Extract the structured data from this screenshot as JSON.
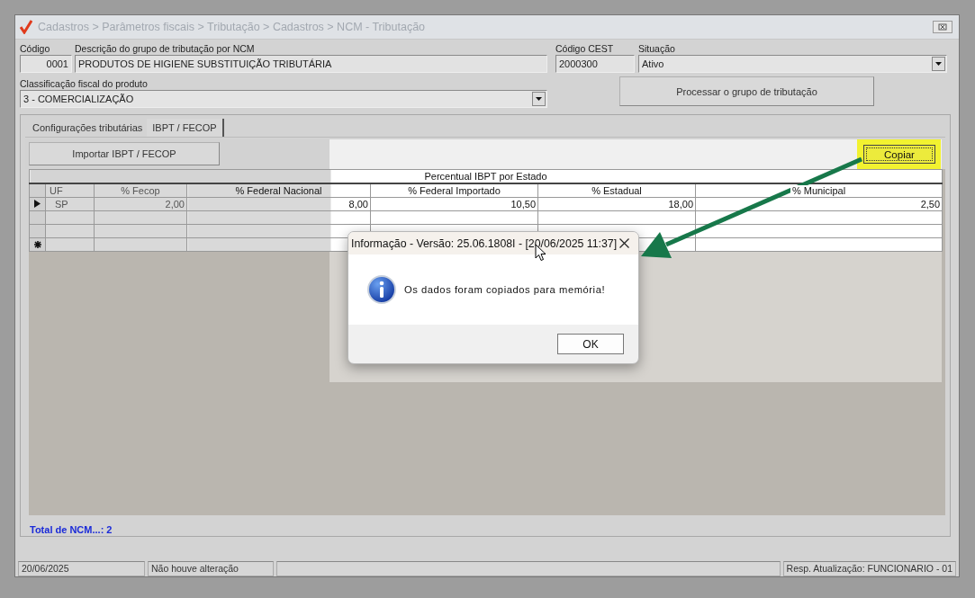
{
  "window": {
    "title": "Cadastros > Parâmetros fiscais > Tributação > Cadastros > NCM - Tributação"
  },
  "form": {
    "codigo": {
      "label": "Código",
      "value": "0001"
    },
    "descricao": {
      "label": "Descrição do grupo de tributação por NCM",
      "value": "PRODUTOS DE HIGIENE SUBSTITUIÇÃO TRIBUTÁRIA"
    },
    "cest": {
      "label": "Código CEST",
      "value": "2000300"
    },
    "situacao": {
      "label": "Situação",
      "value": "Ativo"
    },
    "classificacao": {
      "label": "Classificação fiscal do produto",
      "value": "3 - COMERCIALIZAÇÃO"
    },
    "process_button": "Processar o grupo de tributação"
  },
  "tabs": [
    {
      "label": "Configurações tributárias",
      "selected": false
    },
    {
      "label": "IBPT / FECOP",
      "selected": true
    }
  ],
  "toolbar": {
    "import_button": "Importar IBPT / FECOP",
    "copy_button": {
      "label": "Copiar",
      "highlighted": true
    }
  },
  "grid": {
    "band": "Percentual IBPT por Estado",
    "columns": [
      "UF",
      "% Fecop",
      "% Federal Nacional",
      "% Federal Importado",
      "% Estadual",
      "% Municipal"
    ],
    "rows": [
      {
        "kind": "data",
        "current": true,
        "cells": [
          "SP",
          "2,00",
          "8,00",
          "10,50",
          "18,00",
          "2,50"
        ]
      },
      {
        "kind": "empty",
        "current": false
      },
      {
        "kind": "empty",
        "current": false
      },
      {
        "kind": "new",
        "current": false
      }
    ]
  },
  "total": "Total de NCM...: 2",
  "status_bar": [
    "20/06/2025",
    "Não houve alteração",
    "Resp. Atualização: FUNCIONARIO - 01"
  ],
  "dialog": {
    "title": "Informação - Versão: 25.06.1808I - [20/06/2025 11:37]",
    "message": "Os dados foram copiados para memória!",
    "button": "OK"
  }
}
